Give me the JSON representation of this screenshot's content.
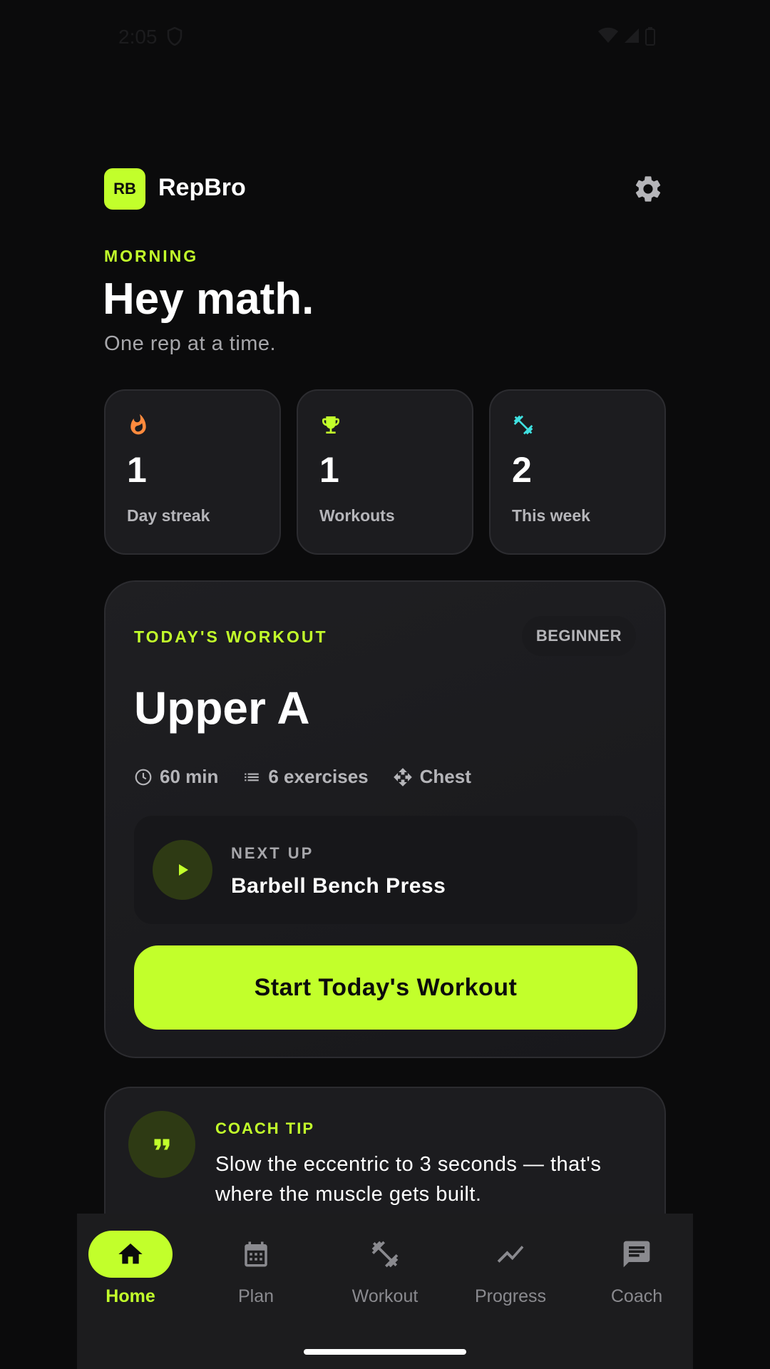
{
  "status_bar": {
    "time": "2:05"
  },
  "header": {
    "logo": "RB",
    "app_name": "RepBro",
    "settings_icon": "gear-icon"
  },
  "greeting": {
    "label": "MORNING",
    "title": "Hey math.",
    "subtitle": "One rep at a time."
  },
  "stats": [
    {
      "icon": "flame-icon",
      "value": "1",
      "label": "Day streak",
      "color": "#ff8a3d"
    },
    {
      "icon": "trophy-icon",
      "value": "1",
      "label": "Workouts",
      "color": "#c2ff2b"
    },
    {
      "icon": "dumbbell-icon",
      "value": "2",
      "label": "This week",
      "color": "#3fe0e0"
    }
  ],
  "workout": {
    "label": "TODAY'S WORKOUT",
    "level": "BEGINNER",
    "title": "Upper A",
    "duration": "60 min",
    "exercises": "6 exercises",
    "focus": "Chest",
    "next_label": "NEXT UP",
    "next_exercise": "Barbell Bench Press",
    "start_label": "Start Today's Workout"
  },
  "tip": {
    "label": "COACH TIP",
    "text": "Slow the eccentric to 3 seconds — that's where the muscle gets built."
  },
  "nav": [
    {
      "label": "Home",
      "icon": "home-icon",
      "active": true
    },
    {
      "label": "Plan",
      "icon": "calendar-icon",
      "active": false
    },
    {
      "label": "Workout",
      "icon": "dumbbell-icon",
      "active": false
    },
    {
      "label": "Progress",
      "icon": "trend-icon",
      "active": false
    },
    {
      "label": "Coach",
      "icon": "chat-icon",
      "active": false
    }
  ],
  "colors": {
    "accent": "#c2ff2b",
    "background": "#0b0b0c",
    "card": "#1c1c1f"
  }
}
